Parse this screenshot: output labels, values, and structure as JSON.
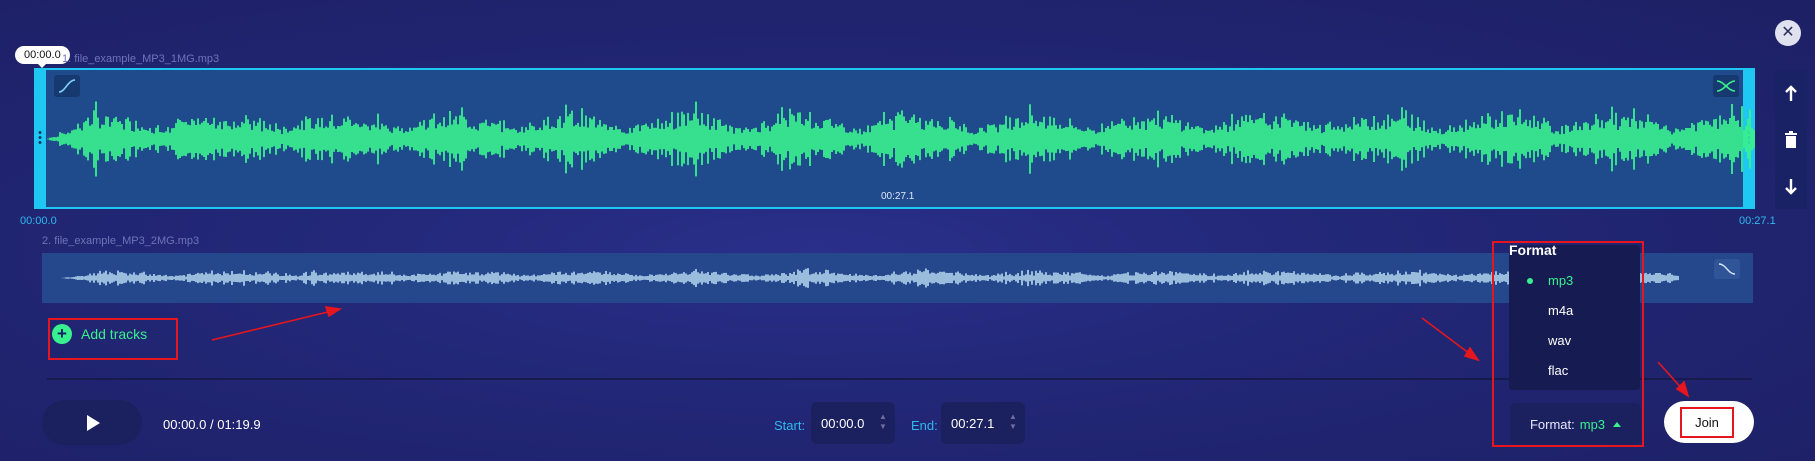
{
  "track1": {
    "name": "1. file_example_MP3_1MG.mp3",
    "playhead": "00:00.0",
    "duration": "00:27.1",
    "axis_start": "00:00.0",
    "axis_end": "00:27.1"
  },
  "track2": {
    "name": "2. file_example_MP3_2MG.mp3"
  },
  "add_tracks": {
    "label": "Add tracks"
  },
  "close": {
    "icon": "close-icon"
  },
  "side_buttons": [
    "arrow-up-icon",
    "trash-icon",
    "arrow-down-icon"
  ],
  "player": {
    "time": "00:00.0 / 01:19.9",
    "start_label": "Start:",
    "start_value": "00:00.0",
    "end_label": "End:",
    "end_value": "00:27.1"
  },
  "format": {
    "dropdown_title": "Format",
    "options": [
      "mp3",
      "m4a",
      "wav",
      "flac"
    ],
    "selected": "mp3",
    "button_label": "Format:",
    "button_value": "mp3"
  },
  "join": {
    "label": "Join"
  },
  "colors": {
    "accent_cyan": "#1ec8f2",
    "wave_green": "#39f08e",
    "annotation_red": "#e5161d"
  }
}
